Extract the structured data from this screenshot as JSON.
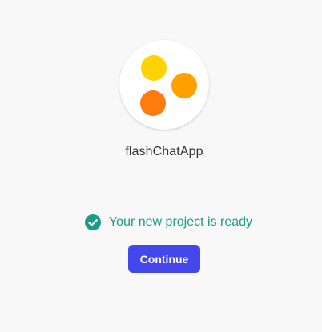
{
  "project": {
    "name": "flashChatApp",
    "logo_icon": "three-dots-logo",
    "logo_colors": [
      "#FFD200",
      "#FFA000",
      "#FF7B0E"
    ]
  },
  "status": {
    "icon": "check-circle-icon",
    "text": "Your new project is ready",
    "color": "#1A9C8A"
  },
  "actions": {
    "continue_label": "Continue",
    "continue_color": "#4447EC"
  }
}
